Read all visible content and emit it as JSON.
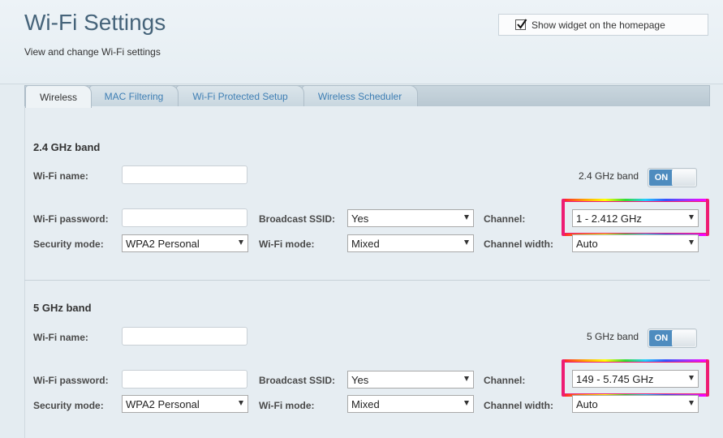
{
  "header": {
    "title": "Wi-Fi Settings",
    "subtitle": "View and change Wi-Fi settings",
    "widget_label": "Show widget on the homepage",
    "widget_checked": true
  },
  "tabs": [
    {
      "label": "Wireless",
      "active": true
    },
    {
      "label": "MAC Filtering",
      "active": false
    },
    {
      "label": "Wi-Fi Protected Setup",
      "active": false
    },
    {
      "label": "Wireless Scheduler",
      "active": false
    }
  ],
  "labels": {
    "wifi_name": "Wi-Fi name:",
    "wifi_password": "Wi-Fi password:",
    "security_mode": "Security mode:",
    "broadcast_ssid": "Broadcast SSID:",
    "wifi_mode": "Wi-Fi mode:",
    "channel": "Channel:",
    "channel_width": "Channel width:"
  },
  "band24": {
    "title": "2.4 GHz band",
    "toggle_label": "2.4 GHz band",
    "toggle_state": "ON",
    "wifi_name_value": "",
    "wifi_password_value": "",
    "security_mode": "WPA2 Personal",
    "broadcast_ssid": "Yes",
    "wifi_mode": "Mixed",
    "channel": "1 - 2.412 GHz",
    "channel_width": "Auto"
  },
  "band5": {
    "title": "5 GHz band",
    "toggle_label": "5 GHz band",
    "toggle_state": "ON",
    "wifi_name_value": "",
    "wifi_password_value": "",
    "security_mode": "WPA2 Personal",
    "broadcast_ssid": "Yes",
    "wifi_mode": "Mixed",
    "channel": "149 - 5.745 GHz",
    "channel_width": "Auto"
  },
  "colors": {
    "title": "#46647a",
    "tab_link": "#3f7fb4",
    "toggle_on": "#4e8cbf",
    "highlight": "#ee1c73"
  }
}
